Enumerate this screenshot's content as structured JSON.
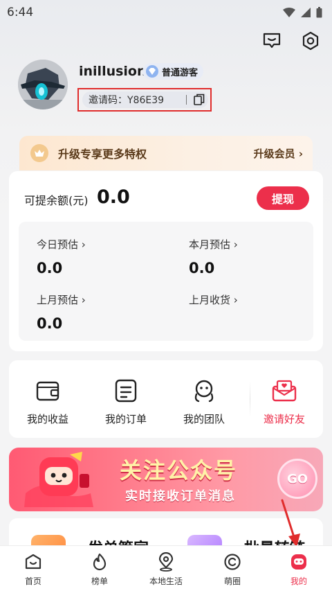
{
  "status_bar": {
    "time": "6:44"
  },
  "profile": {
    "username": "inillusion",
    "badge": "普通游客",
    "invite_code_label": "邀请码：Y86E39"
  },
  "vip_banner": {
    "title": "升级专享更多特权",
    "action": "升级会员 ›"
  },
  "balance": {
    "label": "可提余额(元)",
    "value": "0.0",
    "withdraw_button": "提现",
    "stats": [
      {
        "label": "今日预估 ›",
        "value": "0.0"
      },
      {
        "label": "本月预估 ›",
        "value": "0.0"
      },
      {
        "label": "上月预估 ›",
        "value": "0.0"
      },
      {
        "label": "上月收货 ›",
        "value": ""
      }
    ]
  },
  "actions": [
    {
      "label": "我的收益",
      "icon": "wallet-icon"
    },
    {
      "label": "我的订单",
      "icon": "order-icon"
    },
    {
      "label": "我的团队",
      "icon": "team-icon"
    },
    {
      "label": "邀请好友",
      "icon": "invite-envelope-icon"
    }
  ],
  "promo_banner": {
    "title": "关注公众号",
    "subtitle": "实时接收订单消息",
    "go": "GO"
  },
  "tools": [
    {
      "label": "发单管家"
    },
    {
      "label": "批量转链"
    }
  ],
  "tabs": [
    {
      "label": "首页",
      "icon": "home-icon"
    },
    {
      "label": "榜单",
      "icon": "flame-icon"
    },
    {
      "label": "本地生活",
      "icon": "location-icon"
    },
    {
      "label": "萌圈",
      "icon": "circle-icon"
    },
    {
      "label": "我的",
      "icon": "profile-icon",
      "active": true
    }
  ],
  "colors": {
    "accent": "#ec2f4b",
    "highlight_box": "#e02c2c",
    "vip_text": "#5a3a1a"
  }
}
